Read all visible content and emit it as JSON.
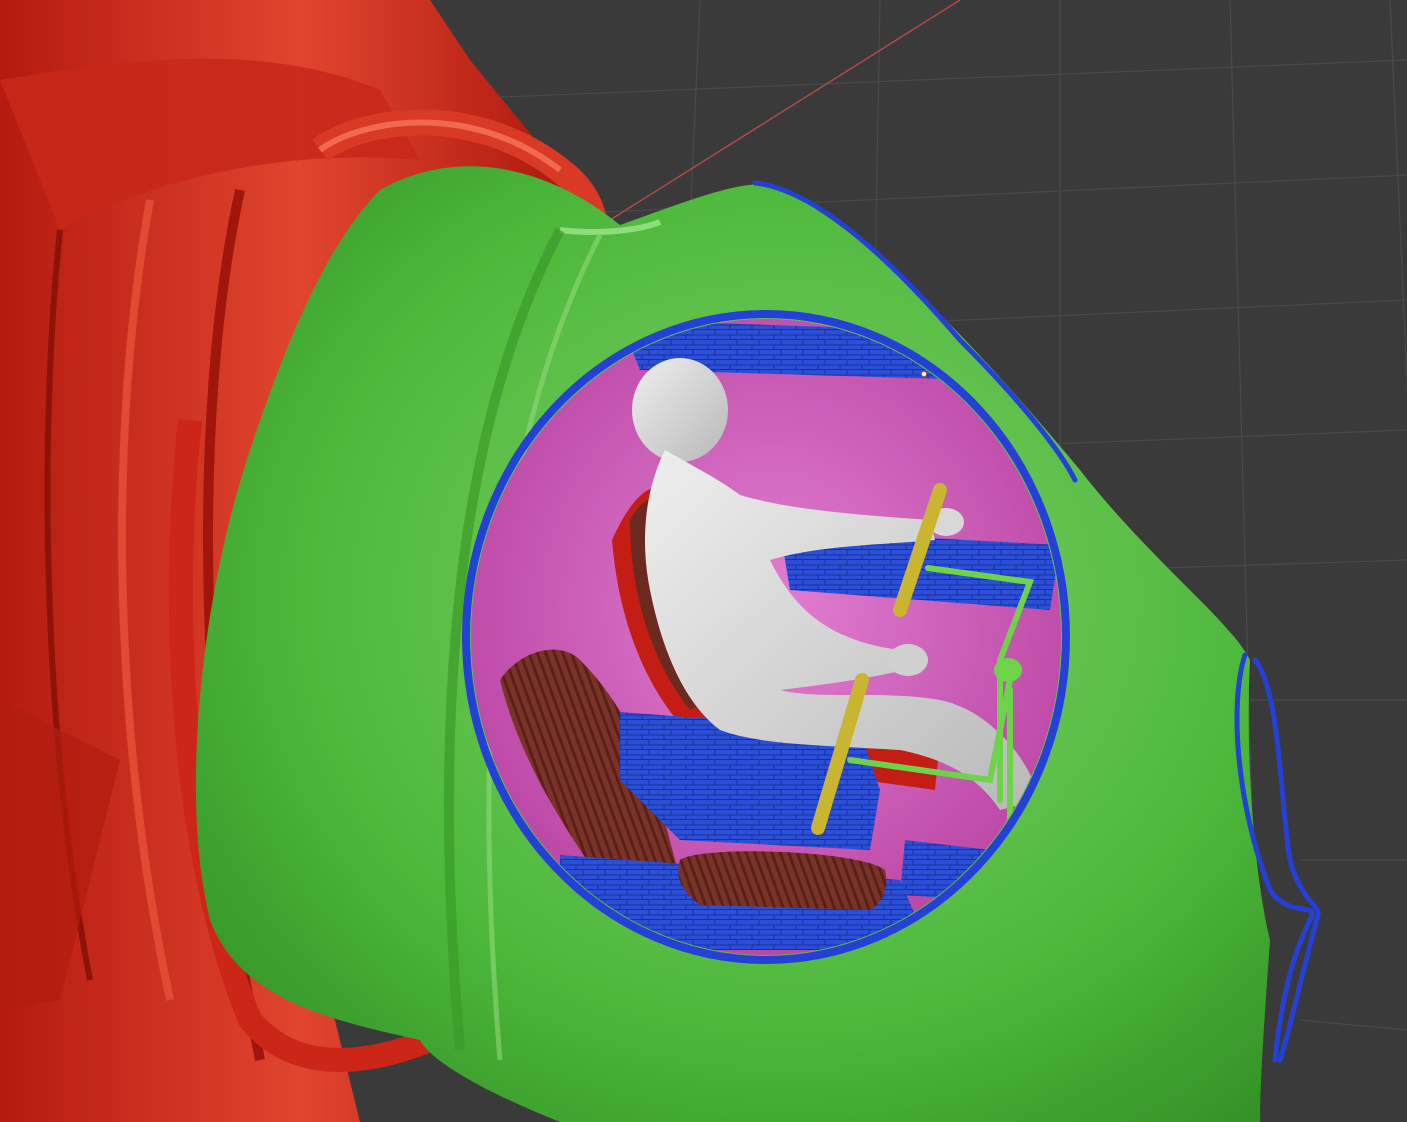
{
  "viewport": {
    "background_color": "#3a3a3a",
    "grid_line_color": "#4a4a4a",
    "x_axis_color": "#b04a4a"
  },
  "scene_objects": [
    {
      "name": "red-outer-ring",
      "color": "#d42a1c"
    },
    {
      "name": "green-shell",
      "color": "#4cb83a"
    },
    {
      "name": "blue-rim",
      "color": "#2440d6"
    },
    {
      "name": "cockpit-interior",
      "color": "#d35fbf"
    },
    {
      "name": "pilot-figure",
      "color": "#d9d9d9"
    },
    {
      "name": "pilot-seat",
      "color": "#c41e14"
    },
    {
      "name": "rear-seat",
      "color": "#6a2a20"
    },
    {
      "name": "control-sticks",
      "color": "#c9b52f"
    },
    {
      "name": "control-linkage",
      "color": "#6dd44a"
    },
    {
      "name": "console-blocks",
      "color": "#2c4fd8"
    }
  ]
}
